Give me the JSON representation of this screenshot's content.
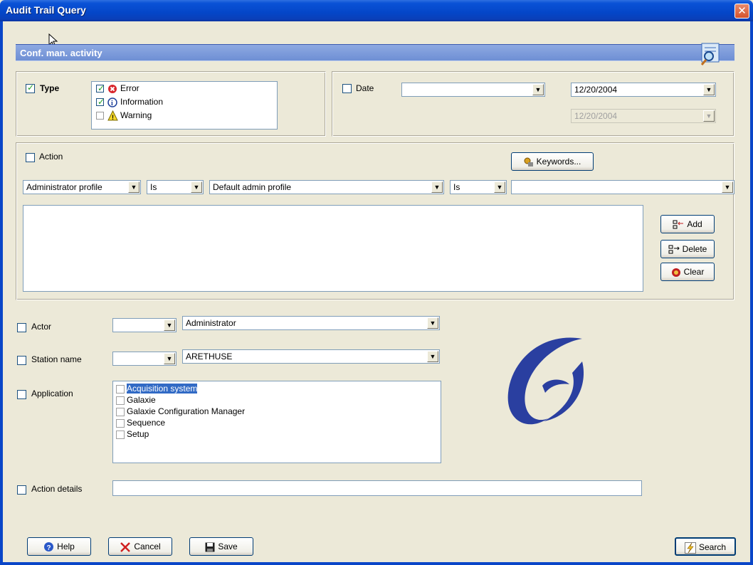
{
  "window": {
    "title": "Audit Trail Query",
    "close": "✕"
  },
  "header": {
    "title": "Conf. man. activity"
  },
  "type_group": {
    "label": "Type",
    "items": [
      {
        "label": "Error",
        "checked": true
      },
      {
        "label": "Information",
        "checked": true
      },
      {
        "label": "Warning",
        "checked": false
      }
    ]
  },
  "date_group": {
    "label": "Date",
    "range_value": "",
    "from": "12/20/2004",
    "to": "12/20/2004"
  },
  "action_group": {
    "label": "Action",
    "keywords_button": "Keywords...",
    "field1": "Administrator profile",
    "op1": "Is",
    "field2": "Default admin profile",
    "op2": "Is",
    "field3": "",
    "add": "Add",
    "delete": "Delete",
    "clear": "Clear"
  },
  "actor": {
    "label": "Actor",
    "op": "",
    "value": "Administrator"
  },
  "station": {
    "label": "Station name",
    "op": "",
    "value": "ARETHUSE"
  },
  "application": {
    "label": "Application",
    "items": [
      "Acquisition system",
      "Galaxie",
      "Galaxie Configuration Manager",
      "Sequence",
      "Setup"
    ]
  },
  "action_details": {
    "label": "Action details",
    "value": ""
  },
  "footer": {
    "help": "Help",
    "cancel": "Cancel",
    "save": "Save",
    "search": "Search"
  }
}
